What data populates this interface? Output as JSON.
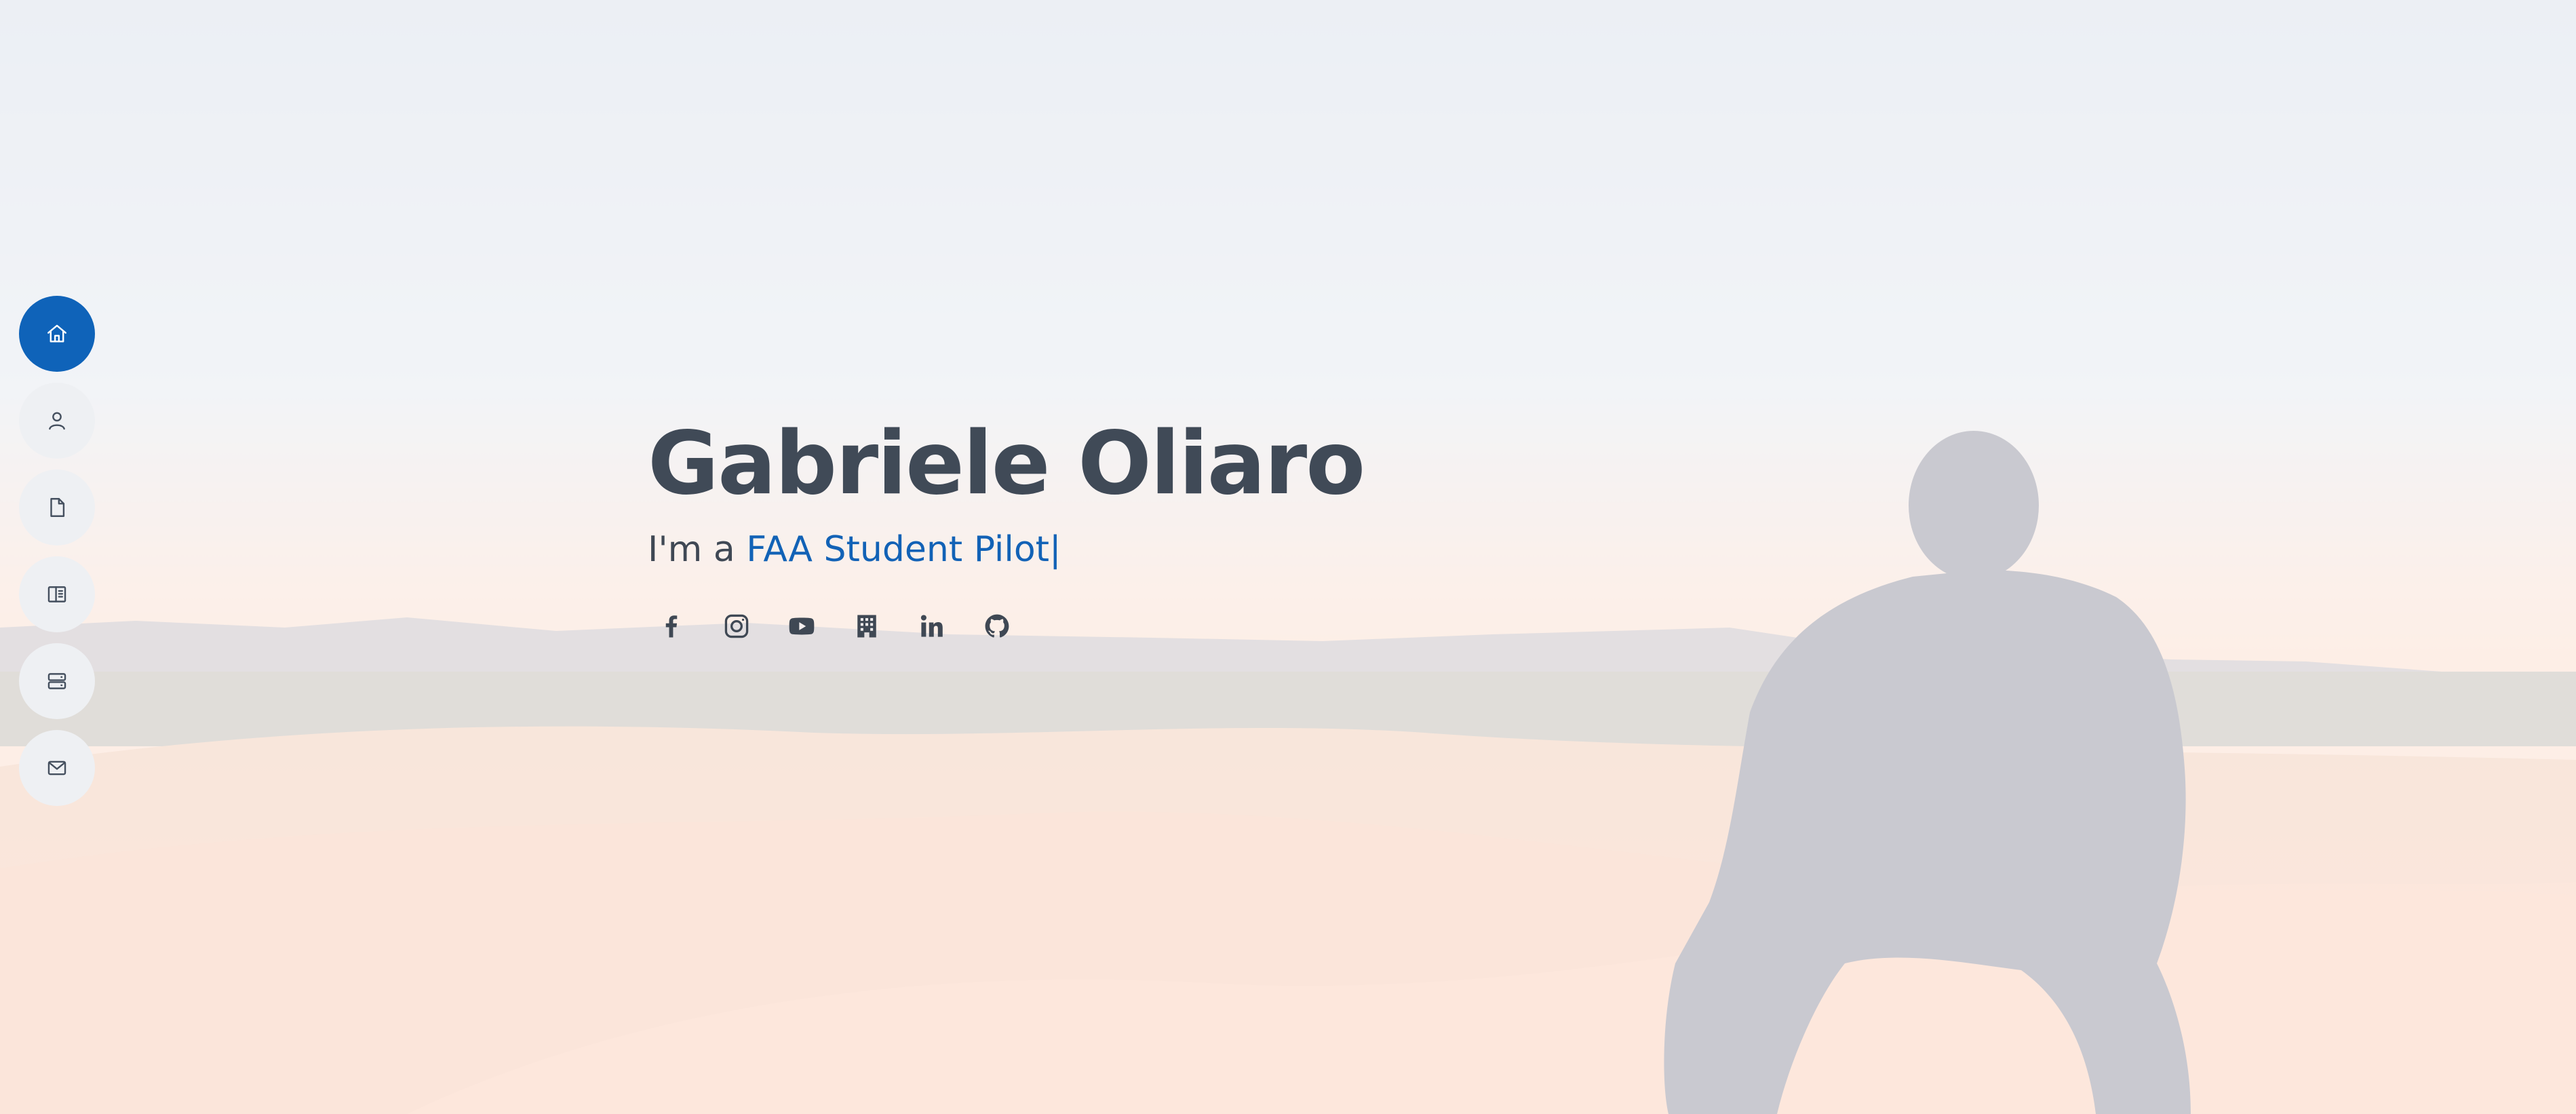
{
  "hero": {
    "name": "Gabriele Oliaro",
    "subtitle_prefix": "I'm a ",
    "typed_role": "FAA Student Pilot",
    "cursor": "|"
  },
  "nav": {
    "items": [
      {
        "icon": "home-icon",
        "active": true
      },
      {
        "icon": "user-icon",
        "active": false
      },
      {
        "icon": "file-icon",
        "active": false
      },
      {
        "icon": "book-icon",
        "active": false
      },
      {
        "icon": "server-icon",
        "active": false
      },
      {
        "icon": "envelope-icon",
        "active": false
      }
    ]
  },
  "social": {
    "links": [
      {
        "icon": "facebook-icon"
      },
      {
        "icon": "instagram-icon"
      },
      {
        "icon": "youtube-icon"
      },
      {
        "icon": "building-icon"
      },
      {
        "icon": "linkedin-icon"
      },
      {
        "icon": "github-icon"
      }
    ]
  },
  "colors": {
    "accent": "#0f63b9",
    "heading": "#404a57",
    "nav_bg": "#eef0f3"
  }
}
